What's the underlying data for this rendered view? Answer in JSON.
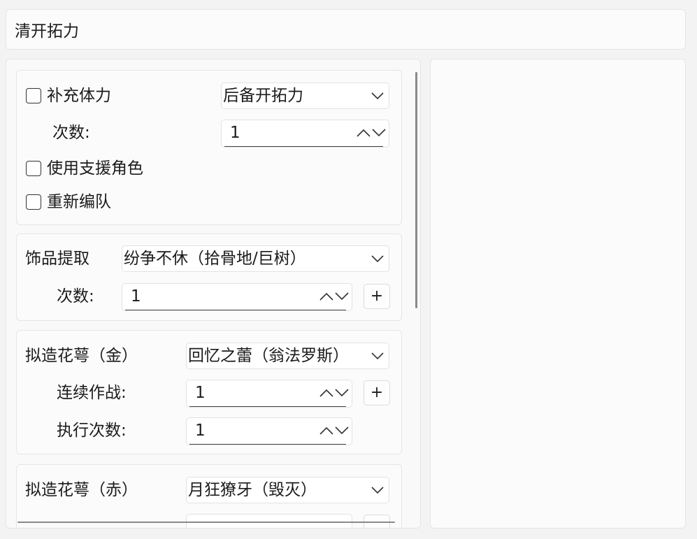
{
  "header": {
    "title": "清开拓力"
  },
  "stamina": {
    "refill_label": "补充体力",
    "refill_checked": false,
    "refill_source": "后备开拓力",
    "count_label": "次数:",
    "count_value": "1",
    "use_support_label": "使用支援角色",
    "use_support_checked": false,
    "reform_team_label": "重新编队",
    "reform_team_checked": false
  },
  "relic": {
    "label": "饰品提取",
    "selected": "纷争不休（拾骨地/巨树）",
    "count_label": "次数:",
    "count_value": "1",
    "add_label": "+"
  },
  "ornament_gold": {
    "label": "拟造花萼（金）",
    "selected": "回忆之蕾（翁法罗斯）",
    "consecutive_label": "连续作战:",
    "consecutive_value": "1",
    "add_label": "+",
    "exec_label": "执行次数:",
    "exec_value": "1"
  },
  "ornament_red": {
    "label": "拟造花萼（赤）",
    "selected": "月狂獠牙（毁灭）"
  },
  "icons": {
    "dropdown": "chevron-down-icon",
    "spin_up": "chevron-up-icon",
    "spin_down": "chevron-down-icon"
  }
}
